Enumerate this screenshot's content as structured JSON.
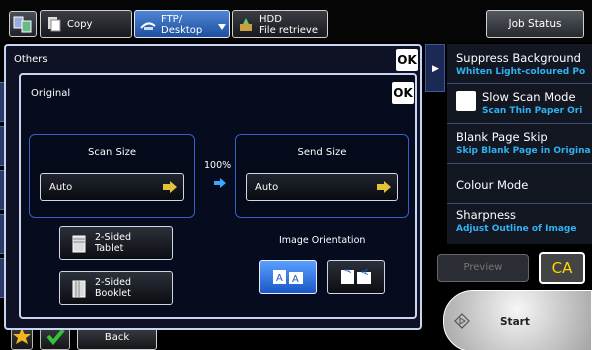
{
  "topbar": {
    "tabs": [
      {
        "label": "Copy",
        "icon": "copy-icon"
      },
      {
        "label_line1": "FTP/",
        "label_line2": "Desktop",
        "icon": "ftp-desktop-icon"
      },
      {
        "label_line1": "HDD",
        "label_line2": "File retrieve",
        "icon": "hdd-icon"
      }
    ],
    "job_status": "Job Status"
  },
  "right_panel": {
    "items": [
      {
        "title": "Suppress Background",
        "sub": "Whiten Light-coloured Po"
      },
      {
        "title": "Slow Scan Mode",
        "sub": "Scan Thin Paper Ori"
      },
      {
        "title": "Blank Page Skip",
        "sub": "Skip Blank Page in Origina"
      },
      {
        "title": "Colour Mode",
        "sub": ""
      },
      {
        "title": "Sharpness",
        "sub": "Adjust Outline of Image"
      }
    ],
    "preview": "Preview",
    "ca": "CA",
    "start": "Start"
  },
  "others_dialog": {
    "title": "Others",
    "ok": "OK"
  },
  "original_dialog": {
    "title": "Original",
    "ok": "OK",
    "scan_size": {
      "label": "Scan Size",
      "value": "Auto"
    },
    "ratio": "100%",
    "send_size": {
      "label": "Send Size",
      "value": "Auto"
    },
    "two_sided_tablet": {
      "line1": "2-Sided",
      "line2": "Tablet"
    },
    "two_sided_booklet": {
      "line1": "2-Sided",
      "line2": "Booklet"
    },
    "image_orientation": {
      "label": "Image Orientation",
      "selected_index": 0
    }
  },
  "bottom": {
    "back": "Back"
  },
  "colors": {
    "accent_blue": "#2fb2f2",
    "ca_yellow": "#ffd800",
    "frame_blue": "#3560c8"
  }
}
